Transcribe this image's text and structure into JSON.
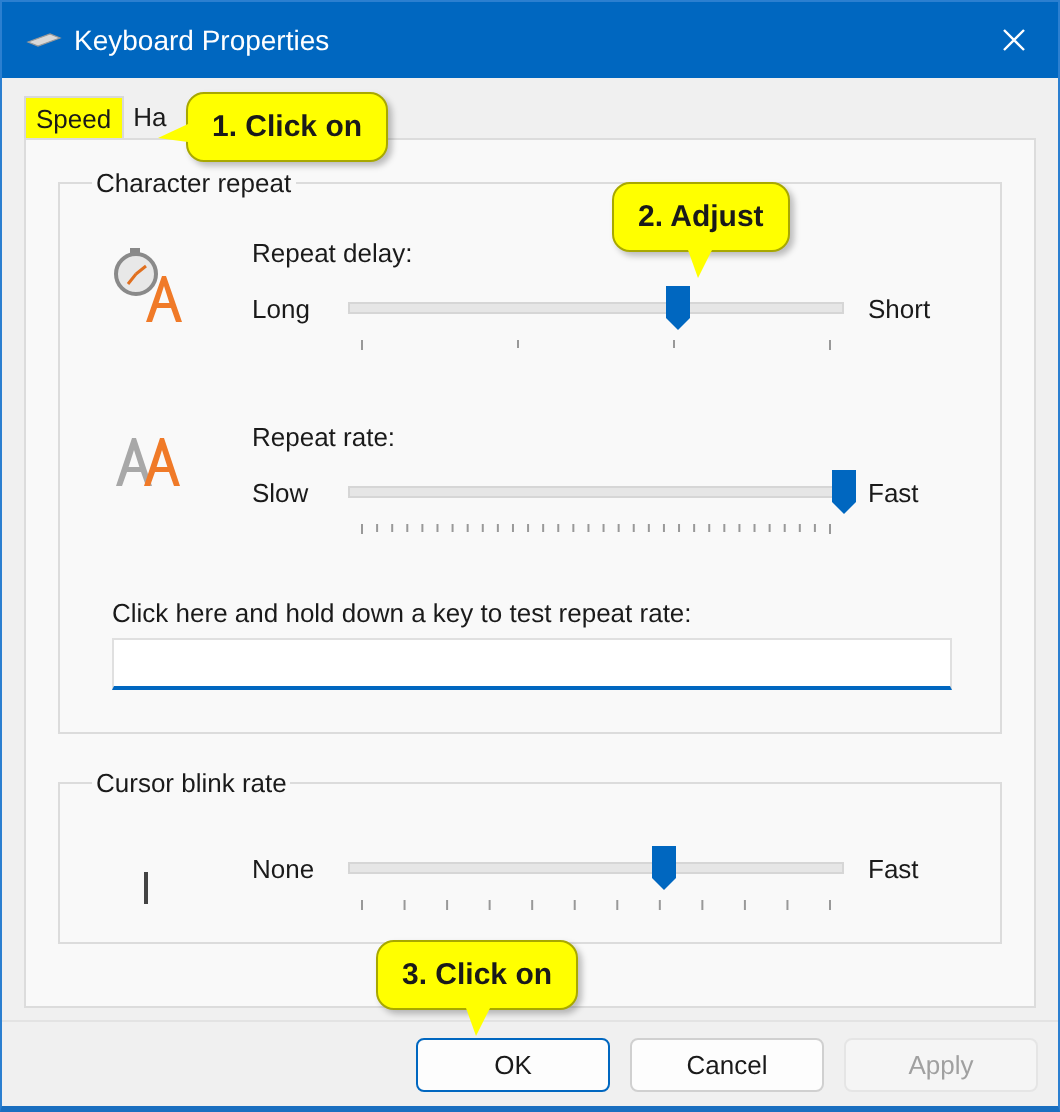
{
  "window": {
    "title": "Keyboard Properties"
  },
  "tabs": [
    {
      "label": "Speed",
      "selected": true,
      "highlighted": true
    },
    {
      "label": "Ha",
      "selected": false,
      "highlighted": false
    }
  ],
  "character_repeat": {
    "title": "Character repeat",
    "sliders": [
      {
        "kind": "delay",
        "label": "Repeat delay:",
        "min_label": "Long",
        "max_label": "Short",
        "level": 0.667
      },
      {
        "kind": "rate",
        "label": "Repeat rate:",
        "min_label": "Slow",
        "max_label": "Fast",
        "level": 1
      }
    ],
    "test_field": {
      "label": "Click here and hold down a key to test repeat rate:"
    }
  },
  "cursor_blink": {
    "title": "Cursor blink rate",
    "slider": {
      "min_label": "None",
      "max_label": "Fast",
      "level": 0.636
    }
  },
  "buttons": [
    {
      "label": "OK",
      "default": true,
      "disabled": false
    },
    {
      "label": "Cancel",
      "default": false,
      "disabled": false
    },
    {
      "label": "Apply",
      "default": false,
      "disabled": true
    }
  ],
  "callouts": [
    {
      "text": "1. Click on",
      "kind": "left-pointer"
    },
    {
      "text": "2. Adjust",
      "kind": "down-pointer"
    },
    {
      "text": "3. Click on",
      "kind": "down-pointer"
    }
  ]
}
